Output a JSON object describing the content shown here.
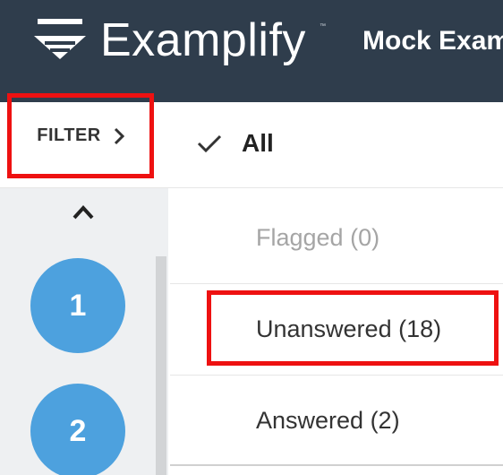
{
  "header": {
    "app_name": "Examplify",
    "trademark": "™",
    "exam_title": "Mock Exam"
  },
  "filter": {
    "label": "FILTER",
    "icon": "chevron-right-icon"
  },
  "filter_options": {
    "all": {
      "label": "All",
      "selected": true,
      "icon": "check-icon"
    },
    "flagged": {
      "label": "Flagged (0)",
      "disabled": true
    },
    "unanswered": {
      "label": "Unanswered (18)"
    },
    "answered": {
      "label": "Answered (2)"
    }
  },
  "sidebar": {
    "scroll_up_icon": "chevron-up-icon",
    "questions": [
      "1",
      "2"
    ]
  },
  "colors": {
    "header_bg": "#2f3d4c",
    "question_circle": "#4da1de",
    "highlight": "#ee1111",
    "sidebar_bg": "#eef0f2"
  }
}
